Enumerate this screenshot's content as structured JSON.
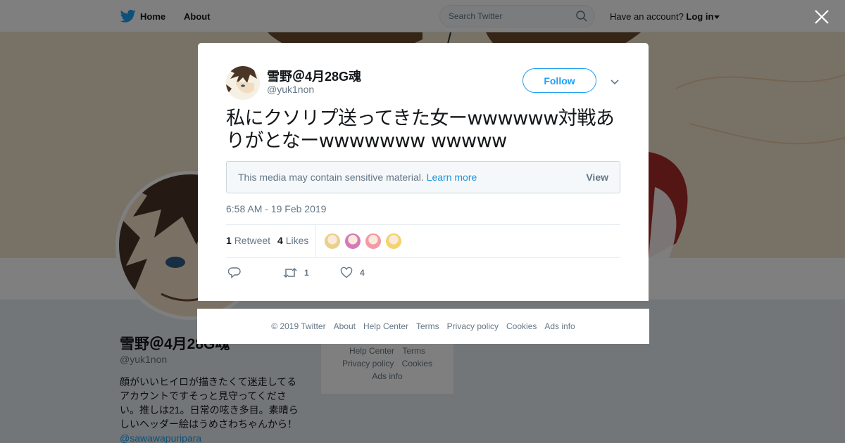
{
  "topbar": {
    "home_label": "Home",
    "about_label": "About",
    "search_placeholder": "Search Twitter",
    "account_prompt": "Have an account?",
    "login_label": "Log in"
  },
  "profile": {
    "name": "雪野＠4月28G魂",
    "handle": "@yuk1non",
    "bio": "顔がいいヒイロが描きたくて迷走してるアカウントですそっと見守ってください。推しは21。日常の呟き多目。素晴らしいヘッダー絵はうめさわちゃんから！",
    "bio_link": "@sawawapuripara"
  },
  "side_links": [
    "Help Center",
    "Terms",
    "Privacy policy",
    "Cookies",
    "Ads info"
  ],
  "tweet": {
    "author_name": "雪野＠4月28G魂",
    "author_handle": "@yuk1non",
    "follow_label": "Follow",
    "text": "私にクソリプ送ってきた女ーwwwwww対戦ありがとなーwwwwwww wwwww",
    "sensitive_notice": "This media may contain sensitive material.",
    "learn_more": "Learn more",
    "view_label": "View",
    "timestamp": "6:58 AM - 19 Feb 2019",
    "retweet_count": "1",
    "retweet_label": "Retweet",
    "like_count": "4",
    "like_label": "Likes",
    "action_retweet_count": "1",
    "action_like_count": "4"
  },
  "likers": [
    {
      "icon": "liker-avatar",
      "color": "#e8d18a"
    },
    {
      "icon": "liker-avatar",
      "color": "#d27bb8"
    },
    {
      "icon": "liker-avatar",
      "color": "#f29aa6"
    },
    {
      "icon": "liker-avatar",
      "color": "#f3d36b"
    }
  ],
  "footer": {
    "copyright": "© 2019 Twitter",
    "links": [
      "About",
      "Help Center",
      "Terms",
      "Privacy policy",
      "Cookies",
      "Ads info"
    ]
  },
  "colors": {
    "twitter_blue": "#1da1f2",
    "link_blue": "#1b95e0",
    "muted_text": "#657786"
  }
}
